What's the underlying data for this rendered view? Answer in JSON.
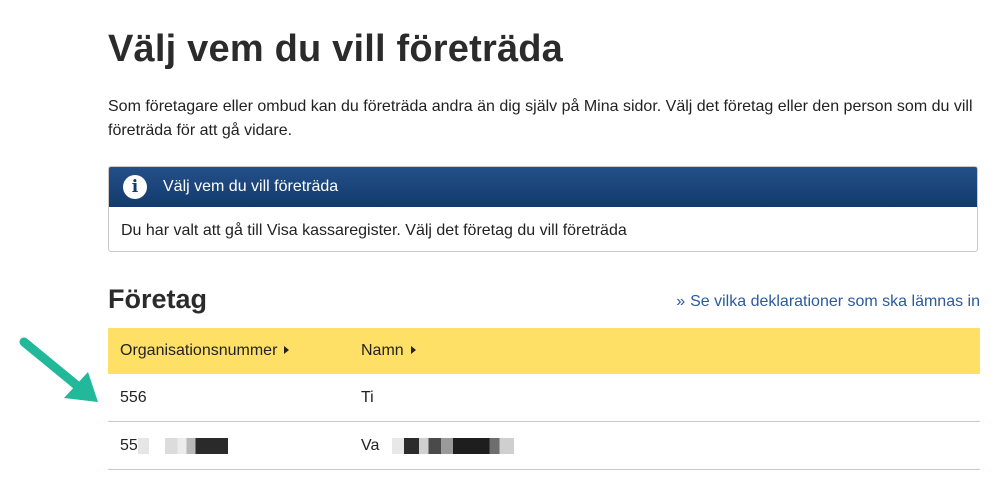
{
  "page": {
    "title": "Välj vem du vill företräda",
    "intro": "Som företagare eller ombud kan du företräda andra än dig själv på Mina sidor. Välj det företag eller den person som du vill företräda för att gå vidare."
  },
  "info_box": {
    "icon": "info-icon",
    "icon_glyph": "i",
    "heading": "Välj vem du vill företräda",
    "body": "Du har valt att gå till Visa kassaregister. Välj det företag du vill företräda",
    "header_color": "#1c477c"
  },
  "companies": {
    "title": "Företag",
    "link_chevron": "»",
    "link_label": "Se vilka deklarationer som ska lämnas in",
    "columns": {
      "org_number": "Organisationsnummer",
      "name": "Namn"
    },
    "rows": [
      {
        "org_number": "556",
        "name": "Ti"
      },
      {
        "org_number": "55",
        "name": "Va"
      }
    ],
    "header_color": "#fde065"
  },
  "annotation": {
    "arrow_color": "#22b89a",
    "icon": "annotation-arrow-icon"
  }
}
